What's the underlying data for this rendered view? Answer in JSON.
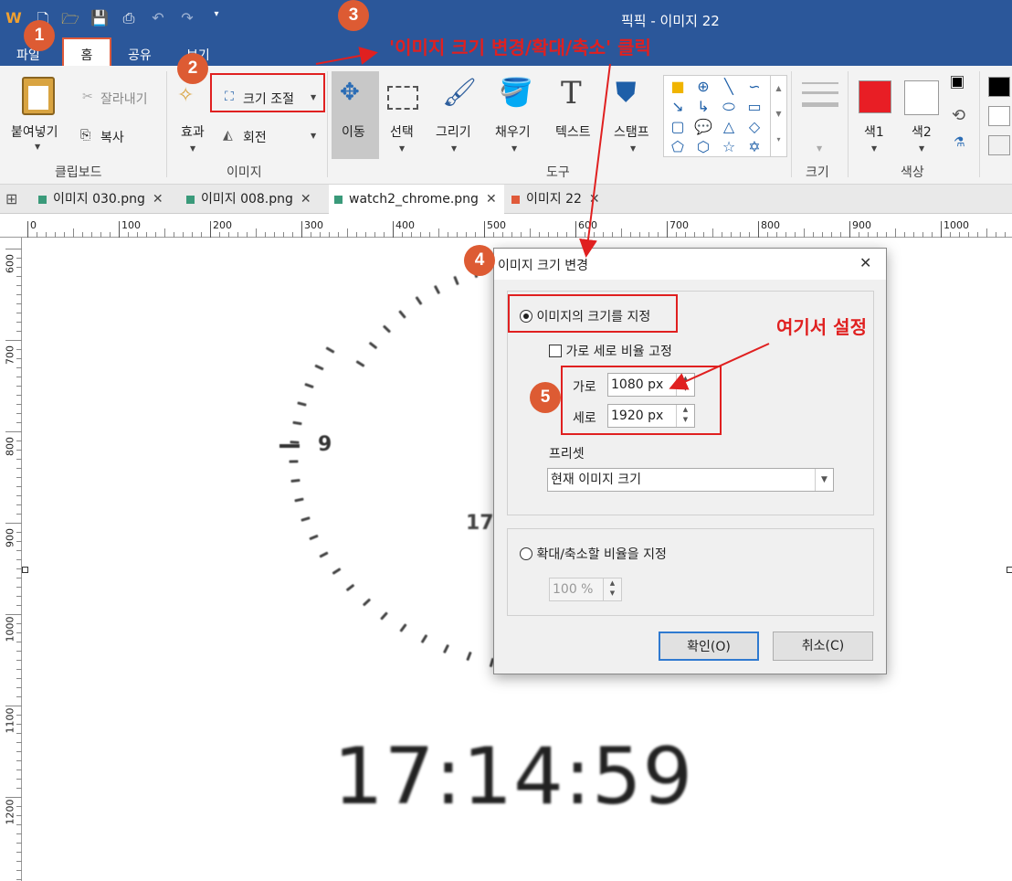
{
  "app": {
    "title": "픽픽 - 이미지 22"
  },
  "ribbon_tabs": [
    "파일",
    "홈",
    "공유",
    "보기"
  ],
  "clipboard": {
    "paste": "붙여넣기",
    "cut": "잘라내기",
    "copy": "복사",
    "group": "클립보드"
  },
  "image": {
    "effects": "효과",
    "resize": "크기 조절",
    "rotate": "회전",
    "group": "이미지"
  },
  "tools": {
    "move": "이동",
    "select": "선택",
    "draw": "그리기",
    "fill": "채우기",
    "text": "텍스트",
    "stamp": "스탬프",
    "group": "도구"
  },
  "size_group": {
    "label": "크기"
  },
  "colors": {
    "color1": "색1",
    "color2": "색2",
    "group": "색상",
    "color1_hex": "#e81e25",
    "color2_hex": "#ffffff",
    "accent": "#2b579a"
  },
  "doc_tabs": [
    {
      "label": "이미지 030.png",
      "close": "✕",
      "color": "#3a9a7a"
    },
    {
      "label": "이미지 008.png",
      "close": "✕",
      "color": "#3a9a7a"
    },
    {
      "label": "watch2_chrome.png",
      "close": "✕",
      "color": "#3a9a7a"
    },
    {
      "label": "이미지 22",
      "close": "✕",
      "color": "#e05a3a"
    }
  ],
  "ruler": {
    "h": [
      "0",
      "100",
      "200",
      "300",
      "400",
      "500",
      "600",
      "700",
      "800",
      "900",
      "1000"
    ],
    "v": [
      "600",
      "700",
      "800",
      "900",
      "1000",
      "1100",
      "1200"
    ]
  },
  "canvas": {
    "clock_time": "17:14:59",
    "dial_nine": "9",
    "dial_seventeen": "17"
  },
  "dialog": {
    "title": "이미지 크기 변경",
    "close": "✕",
    "option_size": "이미지의 크기를 지정",
    "keep_ratio": "가로 세로 비율 고정",
    "width_label": "가로",
    "width_value": "1080 px",
    "height_label": "세로",
    "height_value": "1920 px",
    "preset_label": "프리셋",
    "preset_value": "현재 이미지 크기",
    "option_scale": "확대/축소할 비율을 지정",
    "scale_value": "100 %",
    "ok": "확인(O)",
    "cancel": "취소(C)"
  },
  "annotations": {
    "b1": "1",
    "b2": "2",
    "b3": "3",
    "b4": "4",
    "b5": "5",
    "note3": "'이미지 크기 변경/확대/축소' 클릭",
    "note5": "여기서 설정"
  }
}
